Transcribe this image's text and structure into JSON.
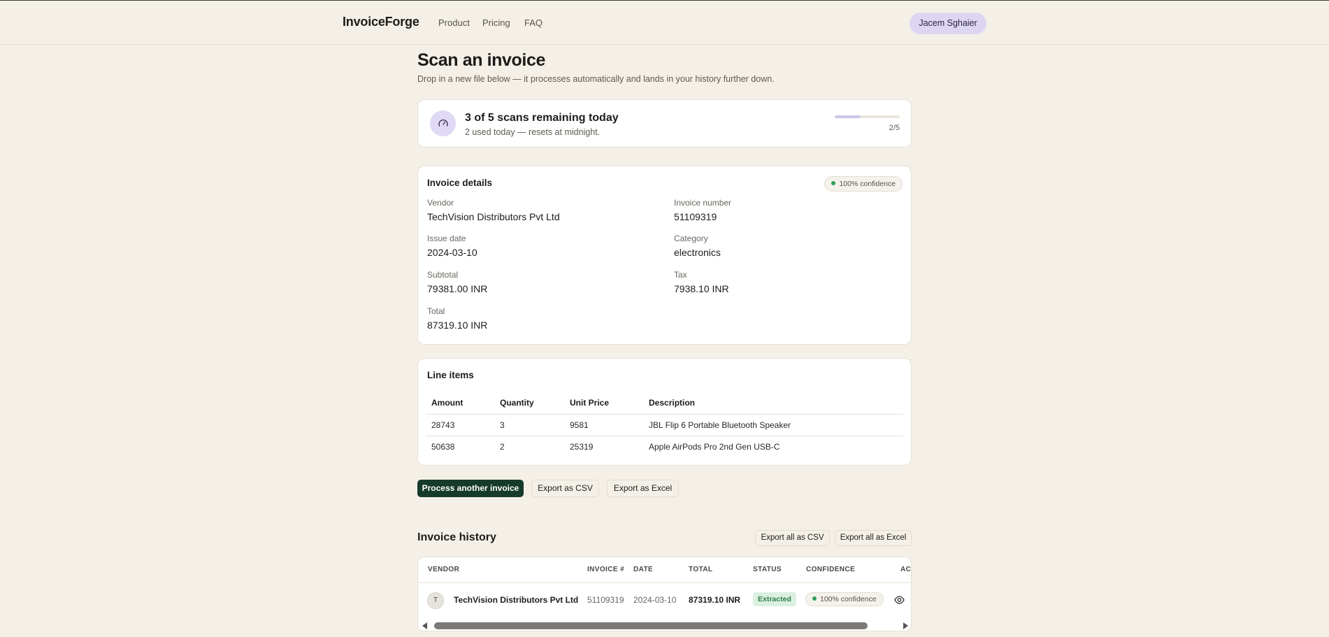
{
  "nav": {
    "brand": "InvoiceForge",
    "links": [
      "Product",
      "Pricing",
      "FAQ"
    ],
    "user": "Jacem Sghaier"
  },
  "page": {
    "title": "Scan an invoice",
    "subtitle": "Drop in a new file below — it processes automatically and lands in your history further down."
  },
  "scans": {
    "title": "3 of 5 scans remaining today",
    "subtitle": "2 used today — resets at midnight.",
    "used_fraction": 0.4,
    "progress_label": "2/5",
    "icon": "gauge-icon"
  },
  "details": {
    "title": "Invoice details",
    "confidence": "100% confidence",
    "vendor_label": "Vendor",
    "vendor": "TechVision Distributors Pvt Ltd",
    "invoice_number_label": "Invoice number",
    "invoice_number": "51109319",
    "issue_date_label": "Issue date",
    "issue_date": "2024-03-10",
    "category_label": "Category",
    "category": "electronics",
    "subtotal_label": "Subtotal",
    "subtotal": "79381.00 INR",
    "tax_label": "Tax",
    "tax": "7938.10 INR",
    "total_label": "Total",
    "total": "87319.10 INR"
  },
  "line_items": {
    "title": "Line items",
    "columns": [
      "Amount",
      "Quantity",
      "Unit Price",
      "Description"
    ],
    "rows": [
      [
        "28743",
        "3",
        "9581",
        "JBL Flip 6 Portable Bluetooth Speaker"
      ],
      [
        "50638",
        "2",
        "25319",
        "Apple AirPods Pro 2nd Gen USB-C"
      ]
    ]
  },
  "actions": {
    "process_another": "Process another invoice",
    "export_csv": "Export as CSV",
    "export_excel": "Export as Excel"
  },
  "history": {
    "title": "Invoice history",
    "export_all_csv": "Export all as CSV",
    "export_all_excel": "Export all as Excel",
    "columns": [
      "VENDOR",
      "INVOICE #",
      "DATE",
      "TOTAL",
      "STATUS",
      "CONFIDENCE",
      "AC"
    ],
    "rows": [
      {
        "avatar": "T",
        "vendor": "TechVision Distributors Pvt Ltd",
        "invoice": "51109319",
        "date": "2024-03-10",
        "total": "87319.10 INR",
        "status": "Extracted",
        "confidence": "100% confidence",
        "action_icon": "eye-icon"
      }
    ]
  },
  "colors": {
    "background": "#f4f0e8",
    "primary_button": "#163b2b",
    "accent_lavender": "#ddd6f2",
    "success": "#2f9e55"
  }
}
